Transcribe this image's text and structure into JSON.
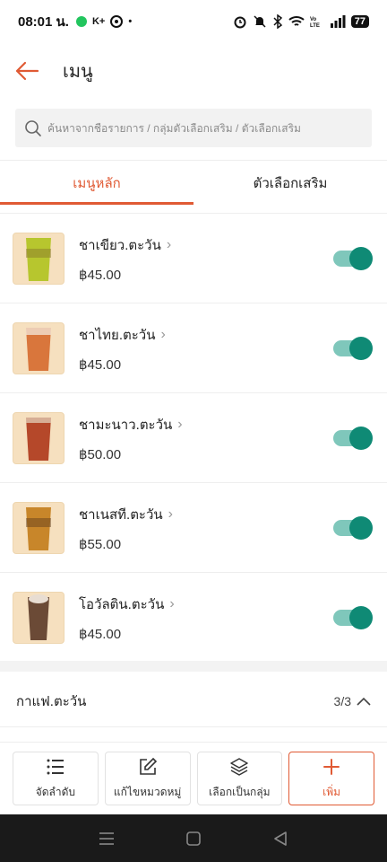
{
  "status_bar": {
    "time": "08:01 น.",
    "icons_left": [
      "line-icon",
      "k-plus-icon",
      "steering-icon"
    ],
    "icons_right": [
      "alarm-icon",
      "mute-icon",
      "bluetooth-icon",
      "wifi-icon",
      "volte-icon",
      "signal-icon"
    ],
    "battery": "77"
  },
  "header": {
    "title": "เมนู"
  },
  "search": {
    "placeholder": "ค้นหาจากชื่อรายการ / กลุ่มตัวเลือกเสริม / ตัวเลือกเสริม"
  },
  "tabs": [
    {
      "label": "เมนูหลัก",
      "active": true
    },
    {
      "label": "ตัวเลือกเสริม",
      "active": false
    }
  ],
  "items": [
    {
      "name": "ชาเขียว.ตะวัน",
      "price": "฿45.00",
      "enabled": true,
      "drink_color": "#b7c62e"
    },
    {
      "name": "ชาไทย.ตะวัน",
      "price": "฿45.00",
      "enabled": true,
      "drink_color": "#d9763c"
    },
    {
      "name": "ชามะนาว.ตะวัน",
      "price": "฿50.00",
      "enabled": true,
      "drink_color": "#b5482a"
    },
    {
      "name": "ชาเนสที.ตะวัน",
      "price": "฿55.00",
      "enabled": true,
      "drink_color": "#c8862a"
    },
    {
      "name": "โอวัลติน.ตะวัน",
      "price": "฿45.00",
      "enabled": true,
      "drink_color": "#6b4a36"
    }
  ],
  "category": {
    "name": "กาแฟ.ตะวัน",
    "count": "3/3"
  },
  "toolbar": {
    "sort_label": "จัดลำดับ",
    "edit_category_label": "แก้ไขหมวดหมู่",
    "group_select_label": "เลือกเป็นกลุ่ม",
    "add_label": "เพิ่ม"
  },
  "colors": {
    "accent": "#e05a34",
    "toggle_on": "#0f8a75"
  }
}
